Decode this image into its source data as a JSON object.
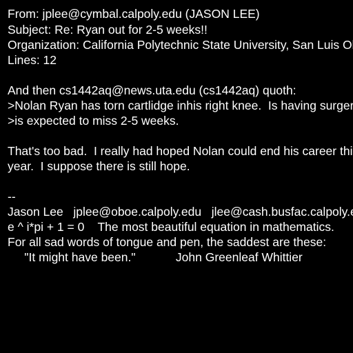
{
  "background": "#000000",
  "text_color": "#ffffff",
  "header": {
    "from": "From: jplee@cymbal.calpoly.edu (JASON LEE)",
    "subject": "Subject: Re: Ryan out for 2-5 weeks!!",
    "organization": "Organization: California Polytechnic State University, San Luis Obispo",
    "lines": "Lines: 12"
  },
  "body": {
    "attribution": "And then cs1442aq@news.uta.edu (cs1442aq) quoth:",
    "quote": [
      ">Nolan Ryan has torn cartlidge inhis right knee.  Is having surgery and",
      ">is expected to miss 2-5 weeks."
    ],
    "reply": [
      "That's too bad.  I really had hoped Nolan could end his career this",
      "year.  I suppose there is still hope."
    ]
  },
  "signature": {
    "separator": "--",
    "lines": [
      "Jason Lee   jplee@oboe.calpoly.edu   jlee@cash.busfac.calpoly.edu",
      "e ^ i*pi + 1 = 0    The most beautiful equation in mathematics.",
      "For all sad words of tongue and pen, the saddest are these:",
      "     \"It might have been.\"            John Greenleaf Whittier        "
    ]
  }
}
